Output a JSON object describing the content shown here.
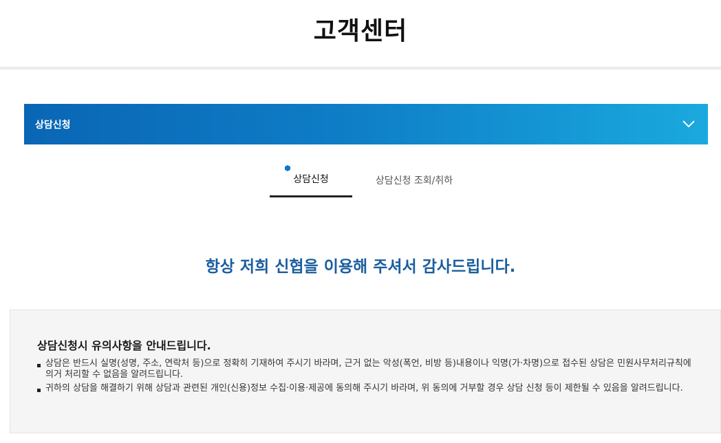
{
  "header": {
    "title": "고객센터"
  },
  "accordion": {
    "label": "상담신청",
    "icon": "chevron-down-icon"
  },
  "tabs": [
    {
      "label": "상담신청",
      "active": true
    },
    {
      "label": "상담신청 조회/취하",
      "active": false
    }
  ],
  "greeting": "항상 저희 신협을 이용해 주셔서 감사드립니다.",
  "notice": {
    "title": "상담신청시 유의사항을 안내드립니다.",
    "items": [
      "상담은 반드시 실명(성명, 주소, 연락처 등)으로 정확히 기재하여 주시기 바라며, 근거 없는 악성(폭언, 비방 등)내용이나 익명(가·차명)으로 접수된 상담은 민원사무처리규칙에 의거 처리할 수 없음을 알려드립니다.",
      "귀하의 상담을 해결하기 위해 상담과 관련된 개인(신용)정보 수집·이용·제공에 동의해 주시기 바라며, 위 동의에 거부할 경우 상담 신청 등이 제한될 수 있음을 알려드립니다."
    ]
  },
  "colors": {
    "accent_start": "#0a66b5",
    "accent_end": "#1aa9de",
    "greeting_text": "#1a5d9e",
    "tab_marker": "#0c78c9",
    "notice_bg": "#f5f5f5"
  }
}
